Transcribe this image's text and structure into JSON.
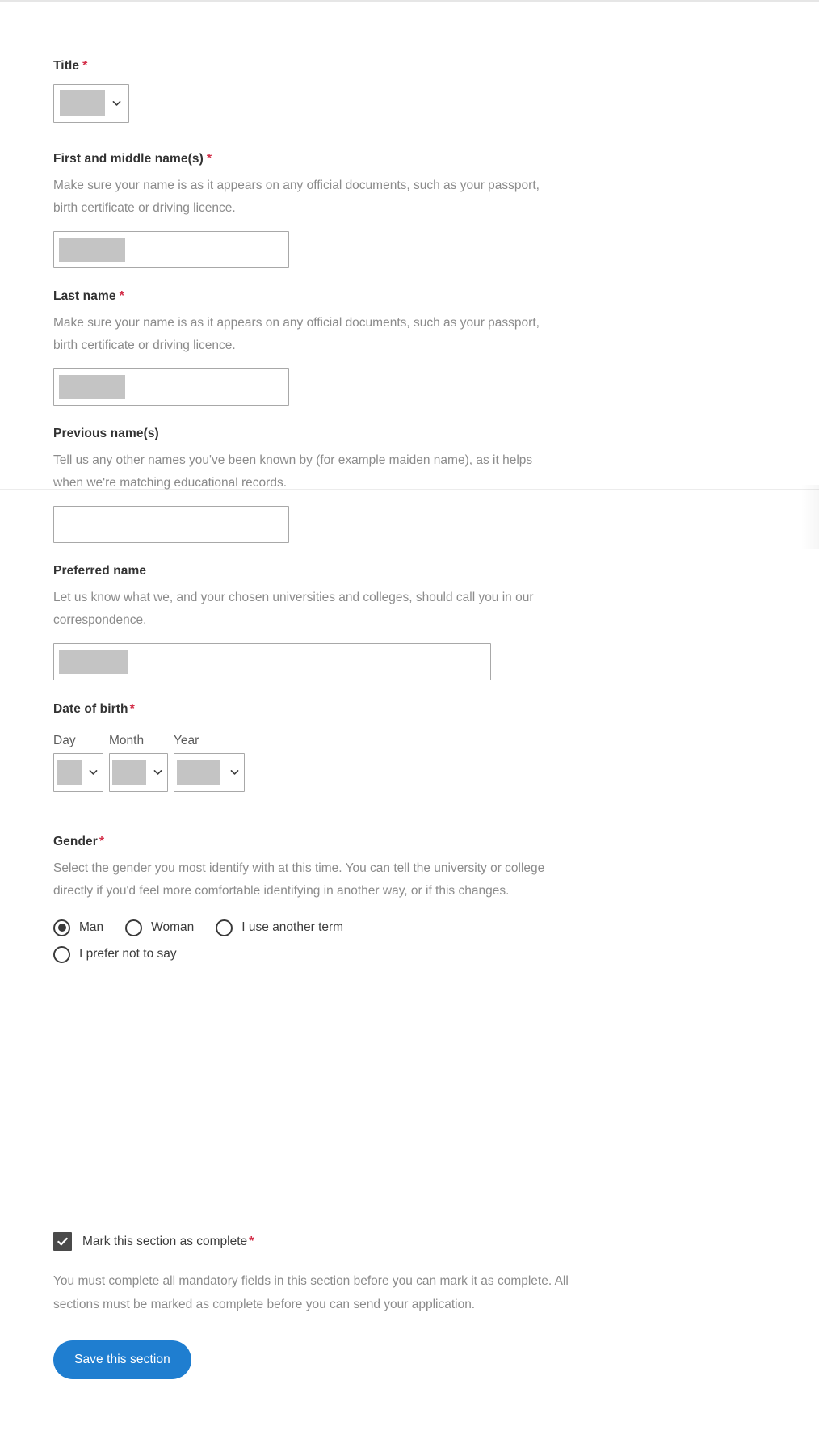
{
  "form": {
    "title_field": {
      "label": "Title",
      "required_marker": "*",
      "value_masked": true
    },
    "first_name": {
      "label": "First and middle name(s)",
      "required_marker": "*",
      "hint": "Make sure your name is as it appears on any official documents, such as your passport, birth certificate or driving licence.",
      "value_masked": true
    },
    "last_name": {
      "label": "Last name",
      "required_marker": "*",
      "hint": "Make sure your name is as it appears on any official documents, such as your passport, birth certificate or driving licence.",
      "value_masked": true
    },
    "previous_names": {
      "label": "Previous name(s)",
      "hint": "Tell us any other names you've been known by (for example maiden name), as it helps when we're matching educational records.",
      "value": ""
    },
    "preferred_name": {
      "label": "Preferred name",
      "hint": "Let us know what we, and your chosen universities and colleges, should call you in our correspondence.",
      "value_masked": true
    },
    "date_of_birth": {
      "label": "Date of birth",
      "required_marker": "*",
      "day_label": "Day",
      "month_label": "Month",
      "year_label": "Year"
    },
    "gender": {
      "label": "Gender",
      "required_marker": "*",
      "hint": "Select the gender you most identify with at this time. You can tell the university or college directly if you'd feel more comfortable identifying in another way, or if this changes.",
      "options": [
        {
          "label": "Man",
          "selected": true
        },
        {
          "label": "Woman",
          "selected": false
        },
        {
          "label": "I use another term",
          "selected": false
        },
        {
          "label": "I prefer not to say",
          "selected": false
        }
      ]
    },
    "mark_complete": {
      "label": "Mark this section as complete",
      "required_marker": "*",
      "checked": true,
      "hint": "You must complete all mandatory fields in this section before you can mark it as complete. All sections must be marked as complete before you can send your application."
    },
    "save_button": {
      "label": "Save this section"
    }
  },
  "colors": {
    "required_red": "#d4314b",
    "button_blue": "#1f7ed0",
    "checkbox_grey": "#4a4a4a",
    "redaction_grey": "#c4c4c4"
  }
}
